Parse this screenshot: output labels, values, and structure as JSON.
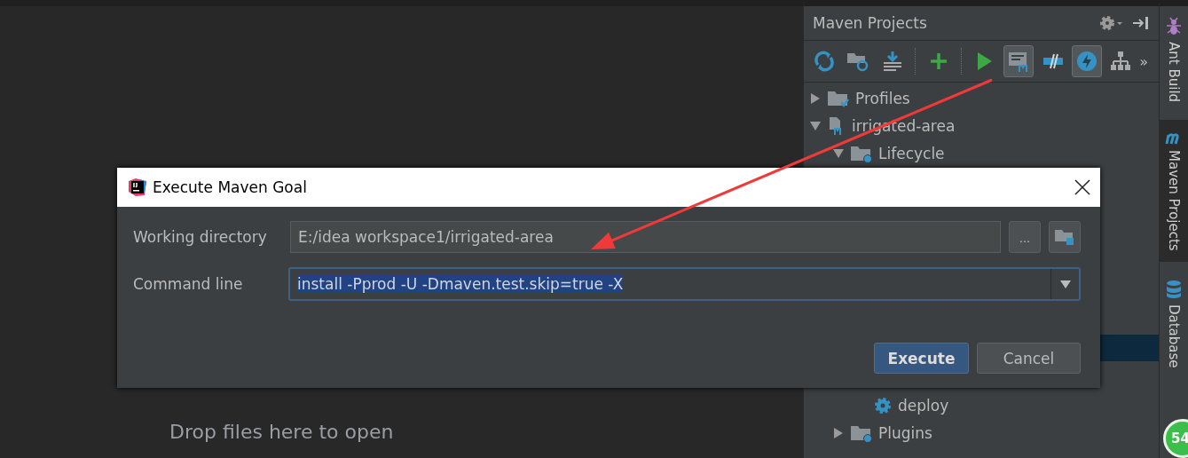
{
  "editor": {
    "hint": "Drop files here to open"
  },
  "maven_panel": {
    "title": "Maven Projects",
    "toolbar": [
      {
        "kind": "refresh",
        "toggled": false
      },
      {
        "kind": "folder-refresh",
        "toggled": false
      },
      {
        "kind": "download",
        "toggled": false
      },
      {
        "kind": "separator"
      },
      {
        "kind": "add",
        "toggled": false
      },
      {
        "kind": "separator"
      },
      {
        "kind": "run",
        "toggled": false
      },
      {
        "kind": "goal",
        "toggled": true
      },
      {
        "kind": "offline",
        "toggled": false
      },
      {
        "kind": "skip-tests",
        "toggled": true
      },
      {
        "kind": "tree",
        "toggled": false
      }
    ],
    "more": "»",
    "tree": [
      {
        "label": "Profiles",
        "kind": "profiles",
        "expanded": false
      },
      {
        "label": "irrigated-area",
        "kind": "project",
        "expanded": true,
        "children": [
          {
            "label": "Lifecycle",
            "kind": "folder",
            "expanded": true,
            "children": [
              {
                "label": "deploy",
                "kind": "goal"
              }
            ]
          },
          {
            "label": "Plugins",
            "kind": "folder",
            "expanded": false
          }
        ]
      }
    ]
  },
  "side_stripe": [
    {
      "label": "Ant Build",
      "kind": "ant",
      "selected": false
    },
    {
      "label": "Maven Projects",
      "kind": "maven",
      "selected": true
    },
    {
      "label": "Database",
      "kind": "database",
      "selected": false
    }
  ],
  "badge": "54",
  "dialog": {
    "title": "Execute Maven Goal",
    "working_directory": {
      "label": "Working directory",
      "value": "E:/idea workspace1/irrigated-area",
      "browse": "..."
    },
    "command_line": {
      "label": "Command line",
      "value": "install -Pprod -U -Dmaven.test.skip=true -X"
    },
    "buttons": [
      {
        "label": "Execute",
        "kind": "primary"
      },
      {
        "label": "Cancel",
        "kind": "secondary"
      }
    ]
  }
}
